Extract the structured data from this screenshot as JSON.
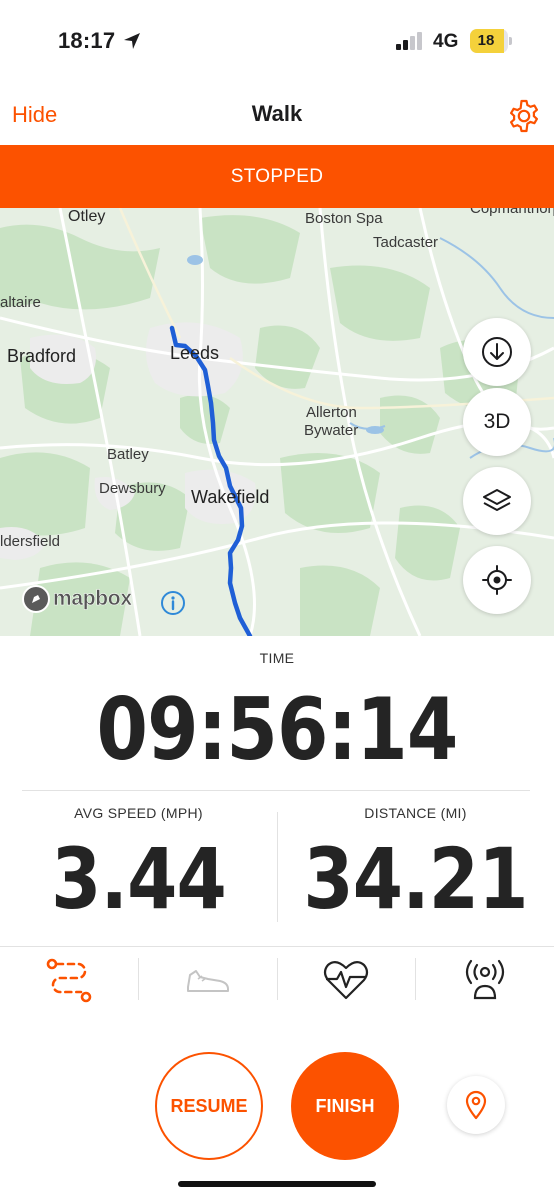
{
  "status_bar": {
    "time": "18:17",
    "network": "4G",
    "battery_level": "18"
  },
  "nav": {
    "hide_label": "Hide",
    "title": "Walk"
  },
  "banner": {
    "status": "STOPPED"
  },
  "map": {
    "places": [
      {
        "name": "Otley"
      },
      {
        "name": "Boston Spa"
      },
      {
        "name": "Copmanthorpe"
      },
      {
        "name": "Tadcaster"
      },
      {
        "name": "altaire"
      },
      {
        "name": "Bradford"
      },
      {
        "name": "Leeds"
      },
      {
        "name": "Allerton"
      },
      {
        "name": "Bywater"
      },
      {
        "name": "Batley"
      },
      {
        "name": "Dewsbury"
      },
      {
        "name": "Wakefield"
      },
      {
        "name": "ldersfield"
      }
    ],
    "attribution": "mapbox",
    "btn_3d_label": "3D",
    "route_color": "#1f5fd6"
  },
  "stats": {
    "time_label": "TIME",
    "time_value": "09:56:14",
    "avg_speed_label": "AVG SPEED (MPH)",
    "avg_speed_value": "3.44",
    "distance_label": "DISTANCE (MI)",
    "distance_value": "34.21"
  },
  "tabs": [
    {
      "icon": "route-icon",
      "active": true
    },
    {
      "icon": "shoe-icon",
      "active": false
    },
    {
      "icon": "heart-rate-icon",
      "active": false
    },
    {
      "icon": "beacon-icon",
      "active": false
    }
  ],
  "actions": {
    "resume_label": "RESUME",
    "finish_label": "FINISH"
  },
  "colors": {
    "accent": "#fc5200",
    "map_background": "#e6efe3",
    "route": "#1f5fd6"
  }
}
